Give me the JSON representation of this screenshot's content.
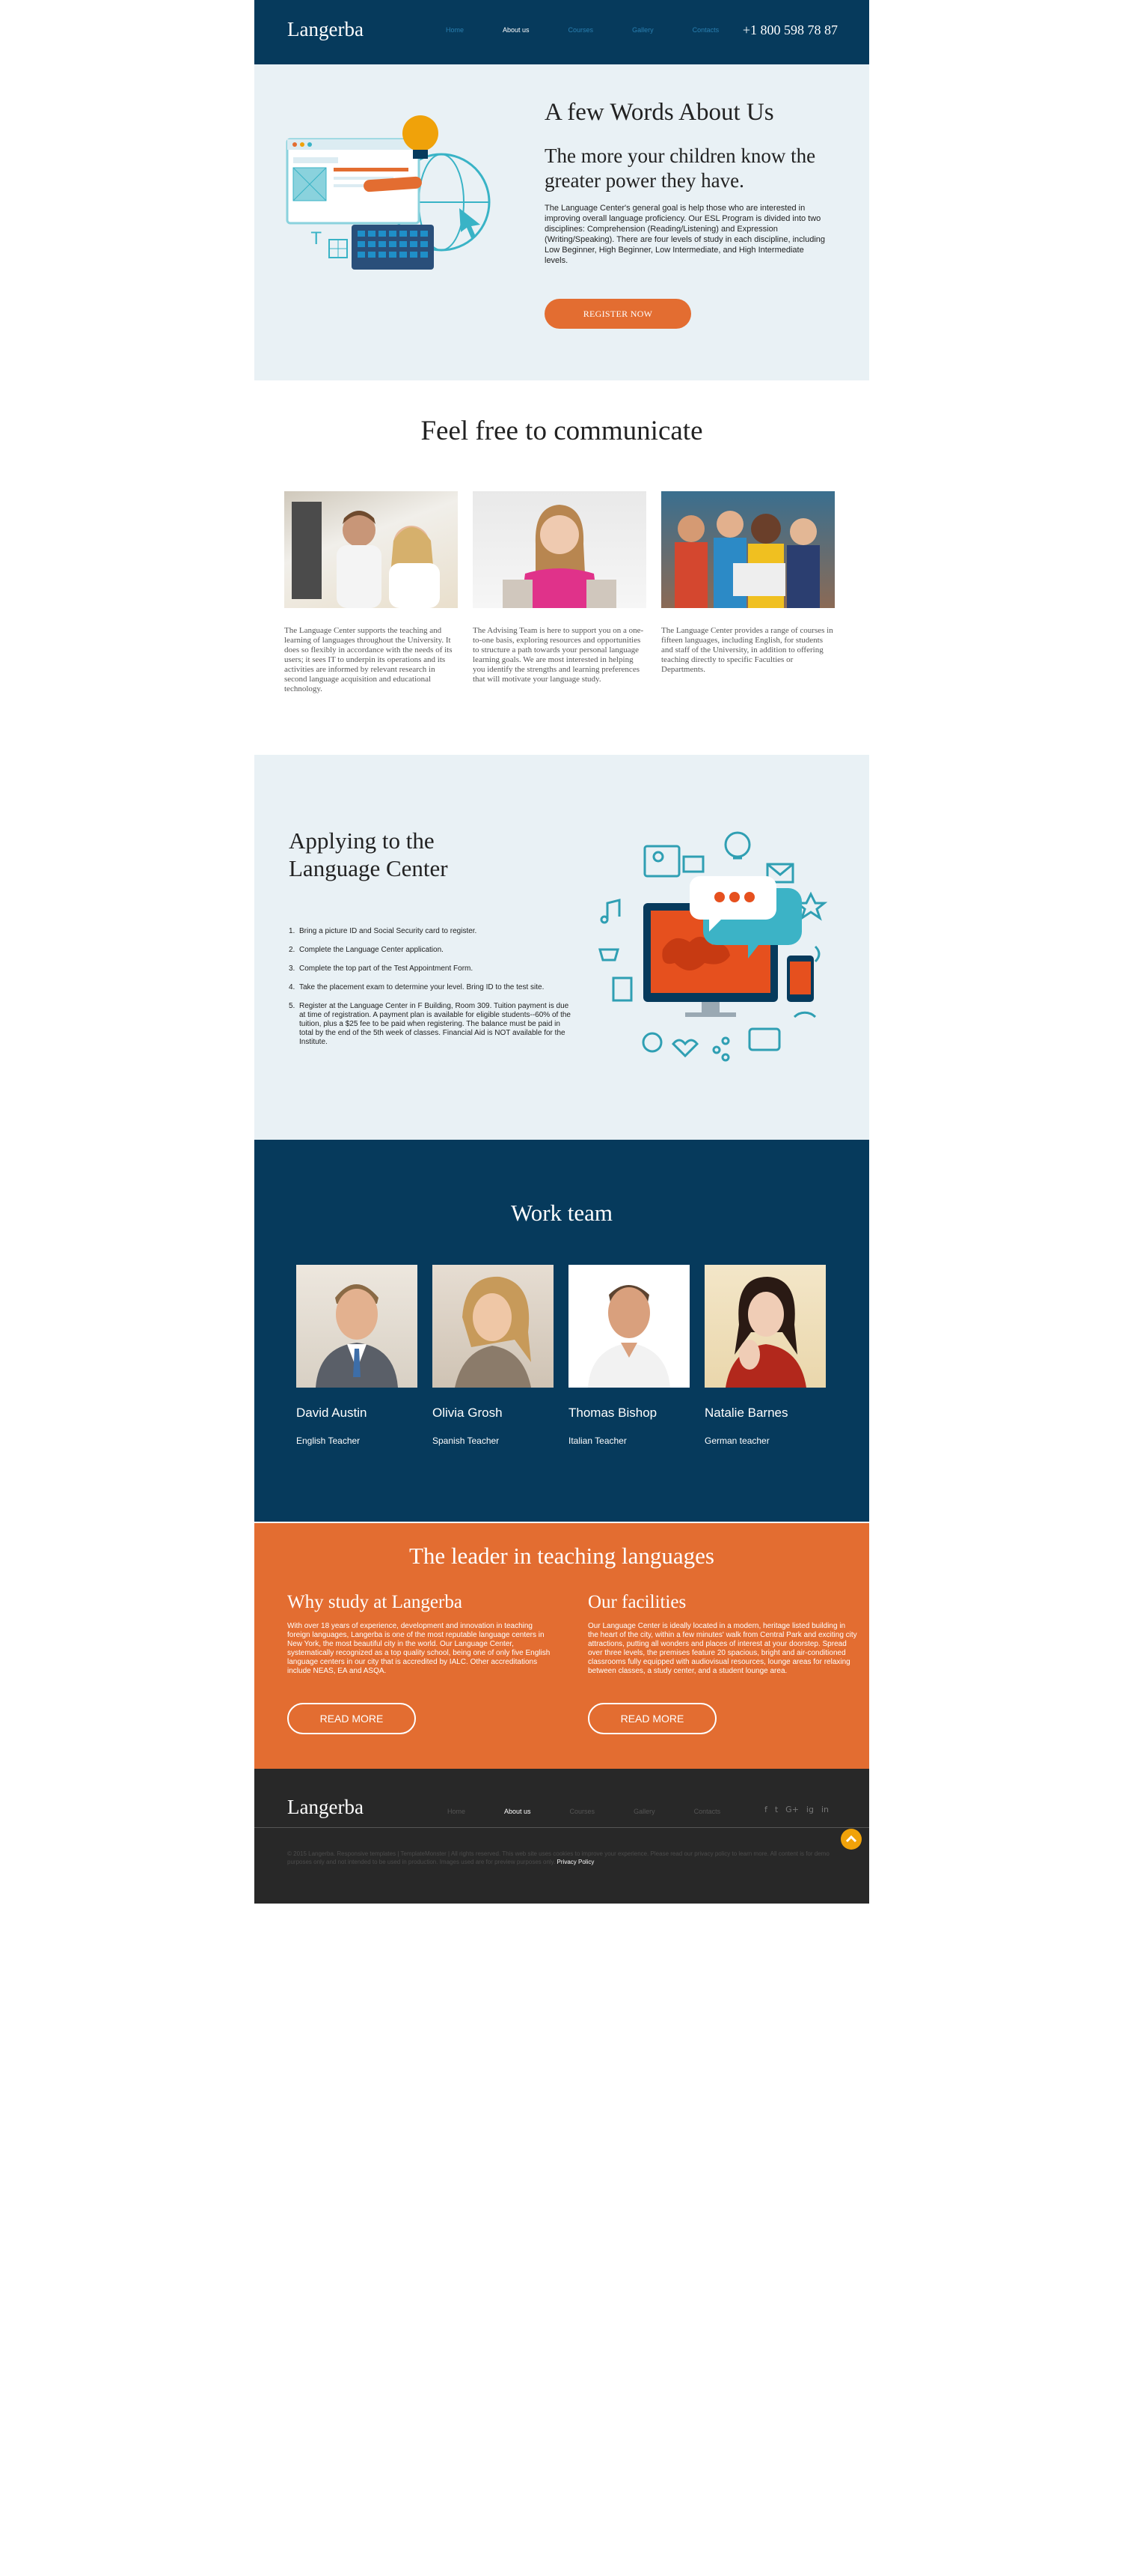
{
  "header": {
    "logo": "Langerba",
    "nav": [
      "Home",
      "About us",
      "Courses",
      "Gallery",
      "Contacts"
    ],
    "active_nav": "About us",
    "phone": "+1 800 598 78 87"
  },
  "about": {
    "title": "A few Words About Us",
    "subtitle": "The more your children know the greater power they have.",
    "text": "The Language Center's general goal is help those who are interested in improving overall language proficiency. Our ESL Program is divided into two disciplines: Comprehension (Reading/Listening) and Expression (Writing/Speaking). There are four levels of study in each discipline, including Low Beginner, High Beginner, Low Intermediate, and High Intermediate levels.",
    "button": "REGISTER NOW"
  },
  "communicate": {
    "title": "Feel free to communicate",
    "cards": [
      {
        "text": "The Language Center supports the teaching and learning of languages throughout the University. It does so flexibly in accordance with the needs of its users; it sees IT to underpin its operations and its activities are informed by relevant research in second language acquisition and educational technology."
      },
      {
        "text": "The Advising Team is here to support you on a one-to-one basis, exploring resources and opportunities to structure a path towards your personal language learning goals. We are most interested in helping you identify the strengths and learning preferences that will motivate your language study."
      },
      {
        "text": "The Language Center provides a range of courses in fifteen languages, including English, for students and staff of the University, in addition to offering teaching directly to specific Faculties or Departments."
      }
    ]
  },
  "apply": {
    "title": "Applying to the Language Center",
    "steps": [
      "Bring a picture ID and Social Security card to register.",
      "Complete the Language Center application.",
      "Complete the top part of the Test Appointment Form.",
      "Take the placement exam to determine your level. Bring ID to the test site.",
      "Register at the Language Center in F Building, Room 309. Tuition payment is due at time of registration. A payment plan is available for eligible students--60% of the tuition, plus a $25 fee to be paid when registering. The balance must be paid in total by the end of the 5th week of classes. Financial Aid is NOT available for the Institute."
    ]
  },
  "team": {
    "title": "Work team",
    "members": [
      {
        "name": "David Austin",
        "role": "English Teacher"
      },
      {
        "name": "Olivia Grosh",
        "role": "Spanish Teacher"
      },
      {
        "name": "Thomas Bishop",
        "role": "Italian Teacher"
      },
      {
        "name": "Natalie Barnes",
        "role": "German teacher"
      }
    ]
  },
  "leader": {
    "title": "The leader in teaching languages",
    "why_title": "Why study at Langerba",
    "why_text": "With over 18 years of experience, development and innovation in teaching foreign languages, Langerba is one of the most reputable language centers in New York, the most beautiful city in the world. Our Language Center, systematically recognized as a top quality school, being one of only five English language centers in our city that is accredited by IALC. Other accreditations include NEAS, EA and ASQA.",
    "fac_title": "Our facilities",
    "fac_text": "Our Language Center is ideally located in a modern, heritage listed building in the heart of the city, within a few minutes' walk from Central Park and exciting city attractions, putting all wonders and places of interest at your doorstep. Spread over three levels, the premises feature 20 spacious, bright and air-conditioned classrooms fully equipped with audiovisual resources, lounge areas for relaxing between classes, a study center, and a student lounge area.",
    "button": "READ MORE"
  },
  "footer": {
    "logo": "Langerba",
    "nav": [
      "Home",
      "About us",
      "Courses",
      "Gallery",
      "Contacts"
    ],
    "active_nav": "About us",
    "social": [
      "f",
      "t",
      "G+",
      "ig",
      "in"
    ],
    "copyright": "© 2015 Langerba. Responsive templates | TemplateMonster | All rights reserved. This web site uses cookies to improve your experience. Please read our privacy policy to learn more. All content is for demo purposes only and not intended to be used in production. Images used are for preview purposes only.",
    "privacy": "Privacy Policy",
    "colors": {
      "navy": "#063a5c",
      "orange": "#e36d31",
      "light": "#e9f1f5",
      "dark": "#282828",
      "accent": "#f0a20a"
    }
  }
}
